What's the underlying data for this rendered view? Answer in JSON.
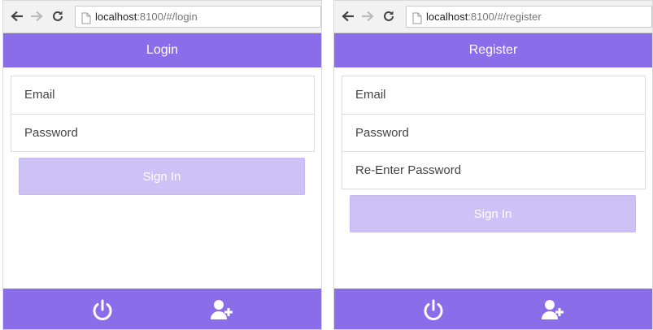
{
  "panels": {
    "login": {
      "url_host": "localhost",
      "url_path": ":8100/#/login",
      "title": "Login",
      "fields": [
        "Email",
        "Password"
      ],
      "button_label": "Sign In"
    },
    "register": {
      "url_host": "localhost",
      "url_path": ":8100/#/register",
      "title": "Register",
      "fields": [
        "Email",
        "Password",
        "Re-Enter Password"
      ],
      "button_label": "Sign In"
    }
  },
  "tabs": [
    "power-icon",
    "add-user-icon"
  ],
  "colors": {
    "accent": "#8a6de9",
    "button_disabled": "#cdc1f5",
    "chrome": "#f2f2f2"
  }
}
